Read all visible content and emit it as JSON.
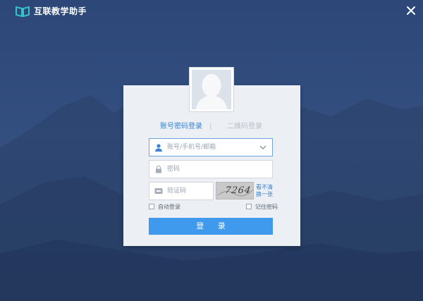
{
  "app": {
    "title": "互联教学助手",
    "logo_icon": "book-logo-icon",
    "close_icon": "close-icon"
  },
  "colors": {
    "background": "#2f4b7c",
    "panel": "#eceff3",
    "accent": "#3a82d2",
    "button": "#3f9aee"
  },
  "login": {
    "tabs": {
      "account": "账号密码登录",
      "separator": "|",
      "qr": "二维码登录"
    },
    "username": {
      "placeholder": "账号/手机号/邮箱",
      "icon": "user-icon",
      "dropdown_icon": "chevron-down-icon"
    },
    "password": {
      "placeholder": "密码",
      "icon": "lock-icon"
    },
    "captcha": {
      "placeholder": "验证码",
      "icon": "captcha-icon",
      "image_text": "7264",
      "refresh_line1": "看不清",
      "refresh_line2": "换一张"
    },
    "auto_login": "自动登录",
    "remember_password": "记住密码",
    "submit": "登 录"
  }
}
